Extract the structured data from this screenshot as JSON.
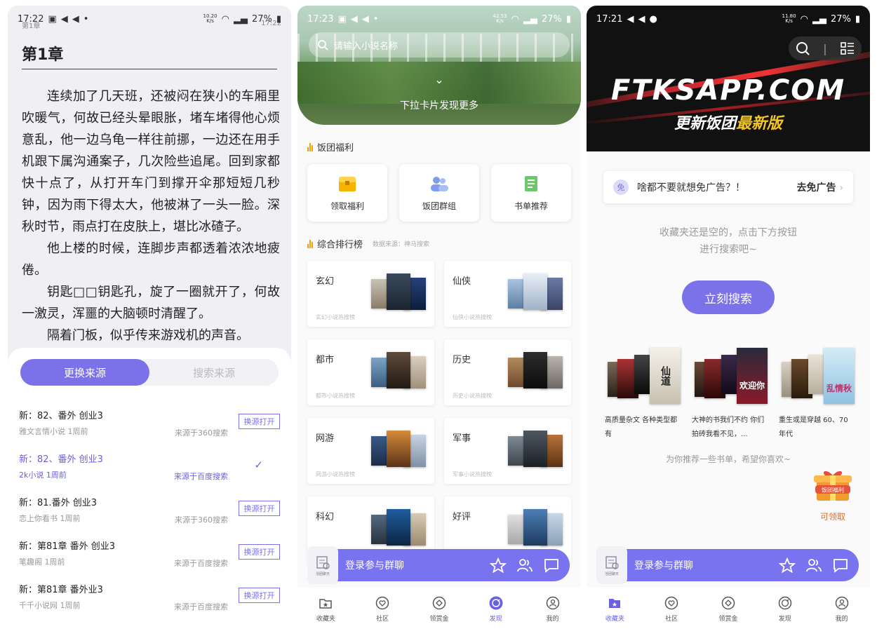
{
  "reader": {
    "status": {
      "time": "17:22",
      "speed_top": "10.20",
      "speed_bottom": "K/s",
      "battery": "27%"
    },
    "ghost_chapter": "第1章",
    "ghost_time": "17:22",
    "chapter_title": "第1章",
    "paragraphs": [
      "连续加了几天班，还被闷在狭小的车厢里吹暖气，何故已经头晕眼胀，堵车堵得他心烦意乱，他一边乌龟一样往前挪，一边还在用手机跟下属沟通案子，几次险些追尾。回到家都快十点了，从打开车门到撑开伞那短短几秒钟，因为雨下得太大，他被淋了一头一脸。深秋时节，雨点打在皮肤上，堪比冰碴子。",
      "他上楼的时候，连脚步声都透着浓浓地疲倦。",
      "钥匙□□钥匙孔，旋了一圈就开了，何故一激灵，浑噩的大脑顿时清醒了。",
      "隔着门板，似乎传来游戏机的声音。"
    ],
    "tabs": [
      "更换来源",
      "搜索来源"
    ],
    "sources": [
      {
        "title": "新：82、番外 创业3",
        "meta": "雅文言情小说  1周前",
        "from": "来源于360搜索",
        "button": "换源打开"
      },
      {
        "title": "新：82、番外 创业3",
        "meta": "2k小说  1周前",
        "from": "来源于百度搜索",
        "button": "✓"
      },
      {
        "title": "新：81.番外 创业3",
        "meta": "恋上你看书  1周前",
        "from": "来源于360搜索",
        "button": "换源打开"
      },
      {
        "title": "新：第81章 番外 创业3",
        "meta": "笔趣阁  1周前",
        "from": "来源于百度搜索",
        "button": "换源打开"
      },
      {
        "title": "新：第81章 番外业3",
        "meta": "千千小说网  1周前",
        "from": "来源于百度搜索",
        "button": "换源打开"
      }
    ]
  },
  "discover": {
    "status": {
      "time": "17:23",
      "speed_top": "42.53",
      "speed_bottom": "K/s",
      "battery": "27%"
    },
    "search_placeholder": "请输入小说名称",
    "pull_text": "下拉卡片发现更多",
    "welfare_title": "饭团福利",
    "welfare": [
      {
        "label": "领取福利",
        "icon": "treasure-chest-icon"
      },
      {
        "label": "饭团群组",
        "icon": "group-icon"
      },
      {
        "label": "书单推荐",
        "icon": "book-list-icon"
      }
    ],
    "rank_title": "综合排行榜",
    "rank_source": "数据来源：神马搜索",
    "ranks": [
      {
        "name": "玄幻",
        "sub": "玄幻小说热搜榜"
      },
      {
        "name": "仙侠",
        "sub": "仙侠小说热搜榜"
      },
      {
        "name": "都市",
        "sub": "都市小说热搜榜"
      },
      {
        "name": "历史",
        "sub": "历史小说热搜榜"
      },
      {
        "name": "网游",
        "sub": "网游小说热搜榜"
      },
      {
        "name": "军事",
        "sub": "军事小说热搜榜"
      },
      {
        "name": "科幻",
        "sub": ""
      },
      {
        "name": "好评",
        "sub": ""
      }
    ],
    "chat_label": "登录参与群聊",
    "chat_badge": "活团聊天",
    "tabs": [
      "收藏夹",
      "社区",
      "领赏金",
      "发现",
      "我的"
    ]
  },
  "shelf": {
    "status": {
      "time": "17:21",
      "speed_top": "11.80",
      "speed_bottom": "K/s",
      "battery": "27%"
    },
    "banner_site": "FTKSAPP.COM",
    "banner_tag_a": "更新饭团",
    "banner_tag_b": "最新版",
    "ad_badge": "免",
    "ad_text": "啥都不要就想免广告？！",
    "ad_go": "去免广告",
    "empty_line1": "收藏夹还是空的，点击下方按钮",
    "empty_line2": "进行搜索吧~",
    "search_button": "立刻搜索",
    "booklists": [
      {
        "text": "高质量杂文 各种类型都有"
      },
      {
        "text": "大神的书我们不约 你们拍砖我看不见，..."
      },
      {
        "text": "重生或是穿越 60、70年代"
      }
    ],
    "cover_titles": [
      "仙道",
      "欢迎你",
      "乱情秋"
    ],
    "recommend_text": "为你推荐一些书单，希望你喜欢~",
    "gift_box_text": "饭团福利",
    "gift_label": "可领取",
    "chat_label": "登录参与群聊",
    "chat_badge": "活团聊天",
    "tabs": [
      "收藏夹",
      "社区",
      "领赏金",
      "发现",
      "我的"
    ]
  }
}
